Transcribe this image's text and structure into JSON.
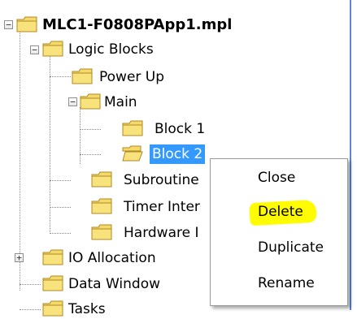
{
  "tree": {
    "root": {
      "label": "MLC1-F0808PApp1.mpl",
      "expander": "−"
    },
    "logic_blocks": {
      "label": "Logic Blocks",
      "expander": "−"
    },
    "power_up": {
      "label": "Power Up"
    },
    "main": {
      "label": "Main",
      "expander": "−"
    },
    "block1": {
      "label": "Block 1"
    },
    "block2": {
      "label": "Block 2",
      "selected": true
    },
    "subroutine": {
      "label": "Subroutine"
    },
    "timer_inter": {
      "label": "Timer Inter"
    },
    "hardware": {
      "label": "Hardware I"
    },
    "io_allocation": {
      "label": "IO Allocation",
      "expander": "+"
    },
    "data_window": {
      "label": "Data Window"
    },
    "tasks": {
      "label": "Tasks"
    }
  },
  "context_menu": {
    "items": [
      "Close",
      "Delete",
      "Duplicate",
      "Rename"
    ],
    "highlighted": "Delete",
    "highlight_color": "#fffb00"
  },
  "colors": {
    "selection": "#3399ff",
    "folder_fill": "#f5d96b",
    "folder_edge": "#b08a20"
  }
}
